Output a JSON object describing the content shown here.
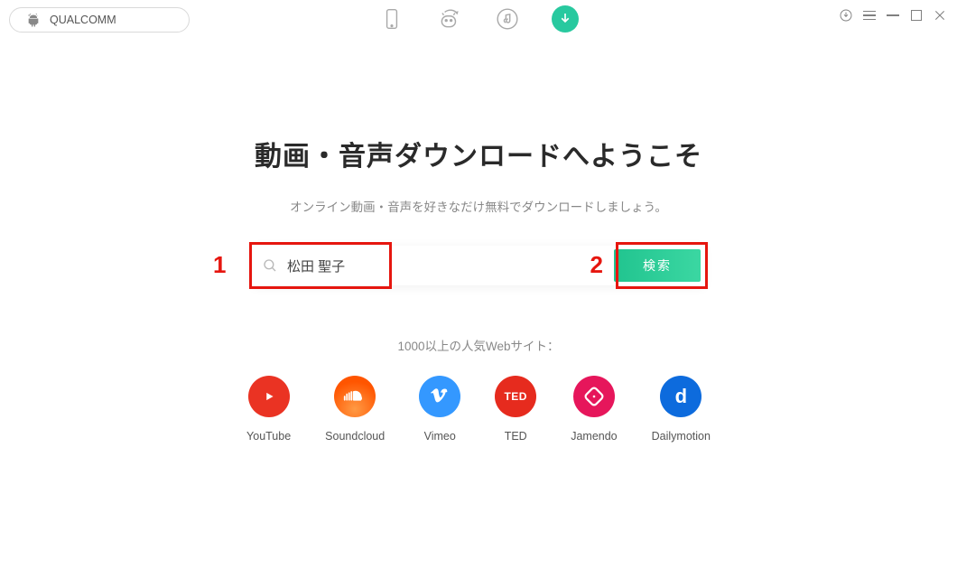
{
  "topbar": {
    "device_name": "QUALCOMM"
  },
  "nav": {
    "tabs": [
      {
        "name": "device"
      },
      {
        "name": "android-transfer"
      },
      {
        "name": "music"
      },
      {
        "name": "download",
        "active": true
      }
    ]
  },
  "main": {
    "headline": "動画・音声ダウンロードへようこそ",
    "subhead": "オンライン動画・音声を好きなだけ無料でダウンロードしましょう。",
    "search_value": "松田 聖子",
    "search_button": "検索",
    "sites_caption": "1000以上の人気Webサイト：",
    "sites": [
      {
        "id": "youtube",
        "label": "YouTube"
      },
      {
        "id": "soundcloud",
        "label": "Soundcloud"
      },
      {
        "id": "vimeo",
        "label": "Vimeo"
      },
      {
        "id": "ted",
        "label": "TED"
      },
      {
        "id": "jamendo",
        "label": "Jamendo"
      },
      {
        "id": "dailymotion",
        "label": "Dailymotion"
      }
    ]
  },
  "annotations": {
    "one": "1",
    "two": "2"
  }
}
